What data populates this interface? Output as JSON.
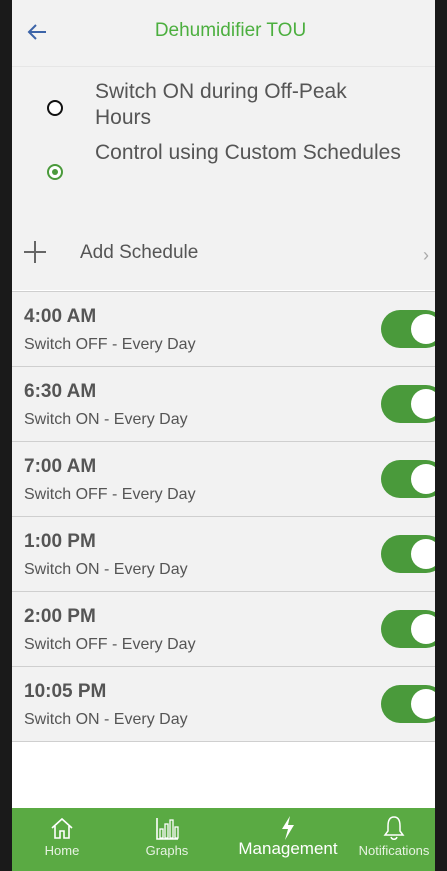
{
  "header": {
    "title": "Dehumidifier TOU",
    "back_icon": "arrow-left-icon"
  },
  "options": [
    {
      "label": "Switch ON during Off-Peak Hours",
      "selected": false
    },
    {
      "label": "Control using Custom Schedules",
      "selected": true
    }
  ],
  "add_schedule": {
    "label": "Add Schedule",
    "icon": "plus-icon",
    "chevron": "›"
  },
  "schedules": [
    {
      "time": "4:00 AM",
      "desc": "Switch OFF - Every Day",
      "enabled": true
    },
    {
      "time": "6:30 AM",
      "desc": "Switch ON - Every Day",
      "enabled": true
    },
    {
      "time": "7:00 AM",
      "desc": "Switch OFF - Every Day",
      "enabled": true
    },
    {
      "time": "1:00 PM",
      "desc": "Switch ON - Every Day",
      "enabled": true
    },
    {
      "time": "2:00 PM",
      "desc": "Switch OFF - Every Day",
      "enabled": true
    },
    {
      "time": "10:05 PM",
      "desc": "Switch ON - Every Day",
      "enabled": true
    }
  ],
  "nav": {
    "items": [
      {
        "label": "Home",
        "icon": "home-icon",
        "active": false
      },
      {
        "label": "Graphs",
        "icon": "bar-chart-icon",
        "active": false
      },
      {
        "label": "Management",
        "icon": "lightning-icon",
        "active": true
      },
      {
        "label": "Notifications",
        "icon": "bell-icon",
        "active": false
      }
    ]
  },
  "colors": {
    "accent_green": "#4a9a3b",
    "nav_green": "#5aaa43",
    "title_green": "#4caf3f",
    "back_blue": "#3c64a8"
  }
}
